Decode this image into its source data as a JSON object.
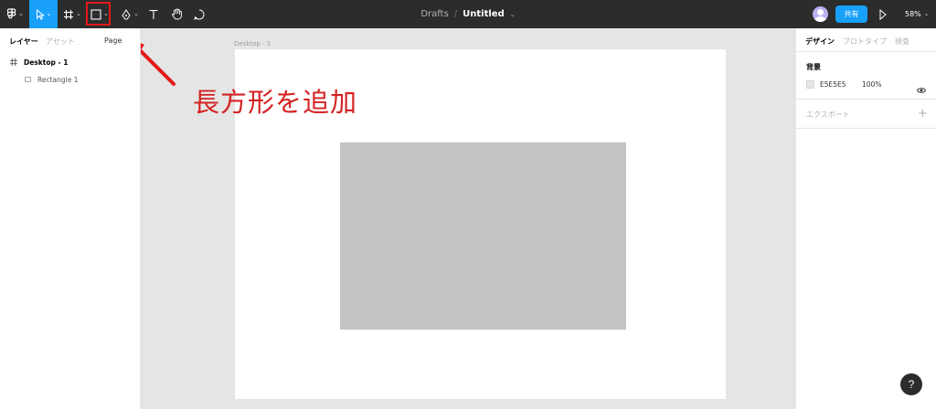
{
  "toolbar": {
    "breadcrumb_drafts": "Drafts",
    "breadcrumb_separator": "/",
    "file_name": "Untitled",
    "share_label": "共有",
    "zoom_label": "58%",
    "tools": [
      "main-menu",
      "move",
      "frame",
      "rectangle",
      "pen",
      "text",
      "hand",
      "comment"
    ],
    "active_tool": "move",
    "highlighted_tool": "rectangle",
    "accent_color": "#18a0fb",
    "highlight_color": "#e51a1a"
  },
  "left_panel": {
    "tab_layers": "レイヤー",
    "tab_assets": "アセット",
    "page_label": "Page",
    "layers": [
      {
        "name": "Desktop - 1",
        "type": "frame"
      },
      {
        "name": "Rectangle 1",
        "type": "rectangle"
      }
    ]
  },
  "canvas": {
    "frame_label": "Desktop - 1",
    "annotation": "長方形を追加",
    "annotation_color": "#d42222",
    "rectangle_fill": "#c4c4c4"
  },
  "right_panel": {
    "tab_design": "デザイン",
    "tab_prototype": "プロトタイプ",
    "tab_inspect": "検査",
    "background_title": "背景",
    "background_hex": "E5E5E5",
    "background_opacity": "100%",
    "export_label": "エクスポート",
    "add_symbol": "+"
  },
  "help": {
    "label": "?"
  }
}
